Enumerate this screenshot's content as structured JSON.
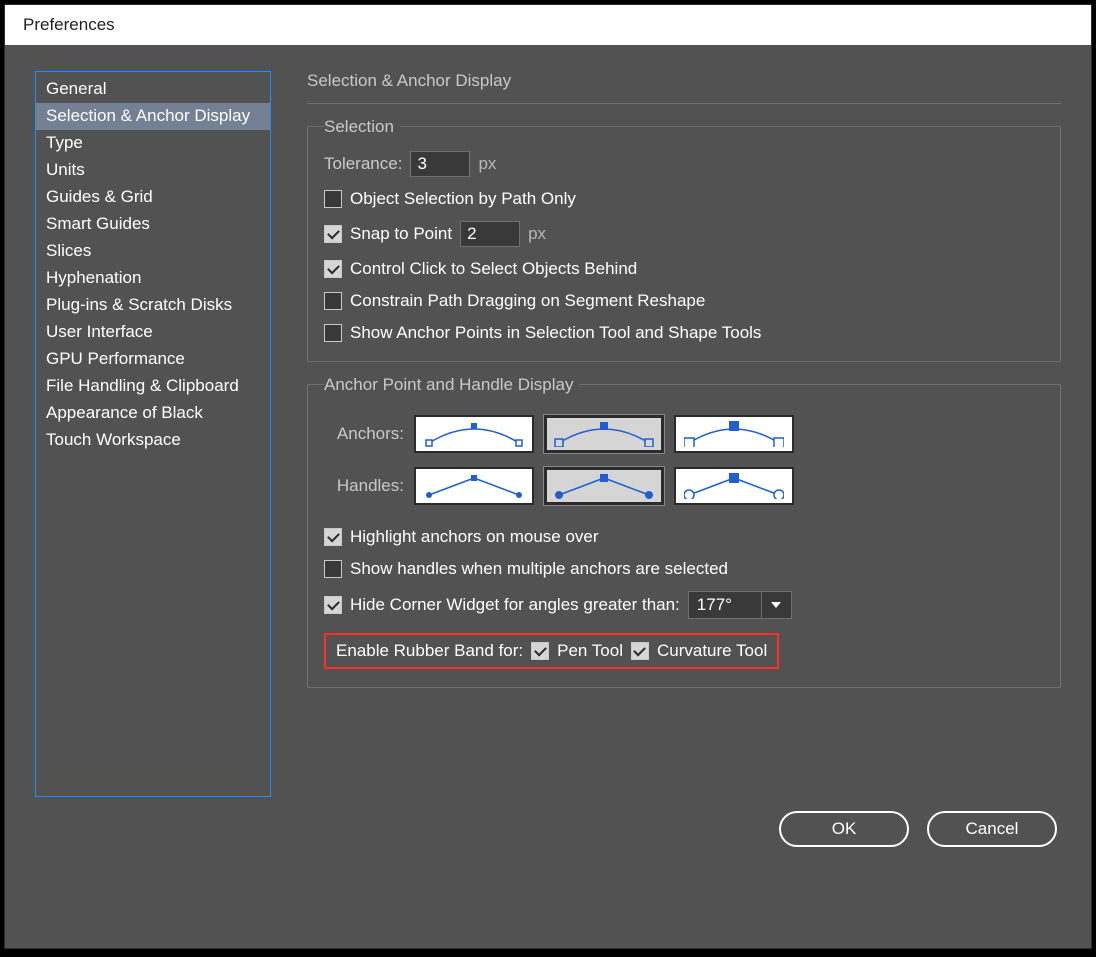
{
  "window_title": "Preferences",
  "sidebar": {
    "items": [
      {
        "label": "General"
      },
      {
        "label": "Selection & Anchor Display",
        "selected": true
      },
      {
        "label": "Type"
      },
      {
        "label": "Units"
      },
      {
        "label": "Guides & Grid"
      },
      {
        "label": "Smart Guides"
      },
      {
        "label": "Slices"
      },
      {
        "label": "Hyphenation"
      },
      {
        "label": "Plug-ins & Scratch Disks"
      },
      {
        "label": "User Interface"
      },
      {
        "label": "GPU Performance"
      },
      {
        "label": "File Handling & Clipboard"
      },
      {
        "label": "Appearance of Black"
      },
      {
        "label": "Touch Workspace"
      }
    ]
  },
  "panel_title": "Selection & Anchor Display",
  "selection_group": {
    "title": "Selection",
    "tolerance_label": "Tolerance:",
    "tolerance_value": "3",
    "tolerance_unit": "px",
    "path_only": {
      "checked": false,
      "label": "Object Selection by Path Only"
    },
    "snap": {
      "checked": true,
      "label": "Snap to Point",
      "value": "2",
      "unit": "px"
    },
    "ctrl_click": {
      "checked": true,
      "label": "Control Click to Select Objects Behind"
    },
    "constrain": {
      "checked": false,
      "label": "Constrain Path Dragging on Segment Reshape"
    },
    "show_anchor": {
      "checked": false,
      "label": "Show Anchor Points in Selection Tool and Shape Tools"
    }
  },
  "anchor_group": {
    "title": "Anchor Point and Handle Display",
    "anchors_label": "Anchors:",
    "handles_label": "Handles:",
    "highlight": {
      "checked": true,
      "label": "Highlight anchors on mouse over"
    },
    "show_handles": {
      "checked": false,
      "label": "Show handles when multiple anchors are selected"
    },
    "hide_corner": {
      "checked": true,
      "label": "Hide Corner Widget for angles greater than:",
      "value": "177°"
    },
    "rubber_band": {
      "label": "Enable Rubber Band for:",
      "pen": {
        "checked": true,
        "label": "Pen Tool"
      },
      "curv": {
        "checked": true,
        "label": "Curvature Tool"
      }
    }
  },
  "footer": {
    "ok": "OK",
    "cancel": "Cancel"
  }
}
